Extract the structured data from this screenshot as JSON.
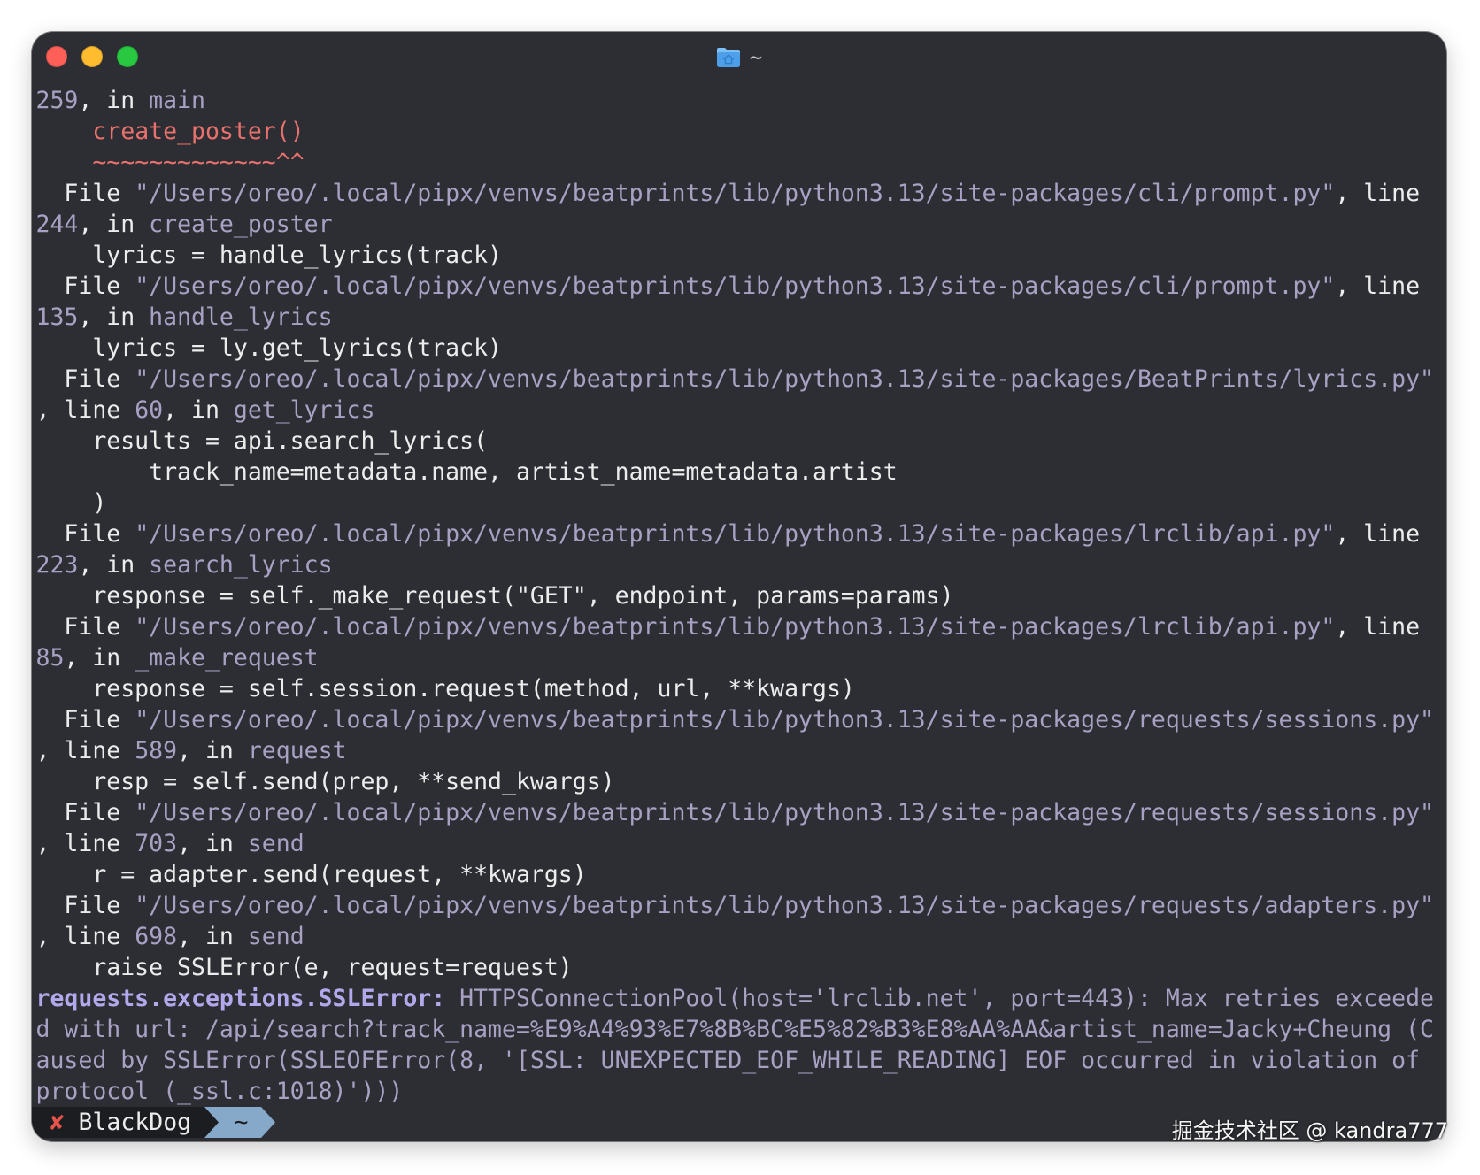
{
  "window": {
    "title": "~",
    "title_icon": "home-folder-icon"
  },
  "terminal": {
    "lines": [
      [
        {
          "text": "259",
          "color": "#a8a1c4"
        },
        {
          "text": ", in "
        },
        {
          "text": "main",
          "color": "#a8a1c4"
        }
      ],
      [
        {
          "text": "    "
        },
        {
          "text": "create_poster()",
          "color": "#e8716d"
        }
      ],
      [
        {
          "text": "    "
        },
        {
          "text": "~~~~~~~~~~~~~^^",
          "color": "#e8716d"
        }
      ],
      [
        {
          "text": "  File "
        },
        {
          "text": "\"/Users/oreo/.local/pipx/venvs/beatprints/lib/python3.13/site-packages/cli/prompt.py\"",
          "color": "#a8a1c4"
        },
        {
          "text": ", line"
        }
      ],
      [
        {
          "text": "244",
          "color": "#a8a1c4"
        },
        {
          "text": ", in "
        },
        {
          "text": "create_poster",
          "color": "#a8a1c4"
        }
      ],
      [
        {
          "text": "    lyrics = handle_lyrics(track)"
        }
      ],
      [
        {
          "text": "  File "
        },
        {
          "text": "\"/Users/oreo/.local/pipx/venvs/beatprints/lib/python3.13/site-packages/cli/prompt.py\"",
          "color": "#a8a1c4"
        },
        {
          "text": ", line"
        }
      ],
      [
        {
          "text": "135",
          "color": "#a8a1c4"
        },
        {
          "text": ", in "
        },
        {
          "text": "handle_lyrics",
          "color": "#a8a1c4"
        }
      ],
      [
        {
          "text": "    lyrics = ly.get_lyrics(track)"
        }
      ],
      [
        {
          "text": "  File "
        },
        {
          "text": "\"/Users/oreo/.local/pipx/venvs/beatprints/lib/python3.13/site-packages/BeatPrints/lyrics.py\"",
          "color": "#a8a1c4"
        }
      ],
      [
        {
          "text": ", line "
        },
        {
          "text": "60",
          "color": "#a8a1c4"
        },
        {
          "text": ", in "
        },
        {
          "text": "get_lyrics",
          "color": "#a8a1c4"
        }
      ],
      [
        {
          "text": "    results = api.search_lyrics("
        }
      ],
      [
        {
          "text": "        track_name=metadata.name, artist_name=metadata.artist"
        }
      ],
      [
        {
          "text": "    )"
        }
      ],
      [
        {
          "text": "  File "
        },
        {
          "text": "\"/Users/oreo/.local/pipx/venvs/beatprints/lib/python3.13/site-packages/lrclib/api.py\"",
          "color": "#a8a1c4"
        },
        {
          "text": ", line"
        }
      ],
      [
        {
          "text": "223",
          "color": "#a8a1c4"
        },
        {
          "text": ", in "
        },
        {
          "text": "search_lyrics",
          "color": "#a8a1c4"
        }
      ],
      [
        {
          "text": "    response = self._make_request(\"GET\", endpoint, params=params)"
        }
      ],
      [
        {
          "text": "  File "
        },
        {
          "text": "\"/Users/oreo/.local/pipx/venvs/beatprints/lib/python3.13/site-packages/lrclib/api.py\"",
          "color": "#a8a1c4"
        },
        {
          "text": ", line"
        }
      ],
      [
        {
          "text": "85",
          "color": "#a8a1c4"
        },
        {
          "text": ", in "
        },
        {
          "text": "_make_request",
          "color": "#a8a1c4"
        }
      ],
      [
        {
          "text": "    response = self.session.request(method, url, **kwargs)"
        }
      ],
      [
        {
          "text": "  File "
        },
        {
          "text": "\"/Users/oreo/.local/pipx/venvs/beatprints/lib/python3.13/site-packages/requests/sessions.py\"",
          "color": "#a8a1c4"
        }
      ],
      [
        {
          "text": ", line "
        },
        {
          "text": "589",
          "color": "#a8a1c4"
        },
        {
          "text": ", in "
        },
        {
          "text": "request",
          "color": "#a8a1c4"
        }
      ],
      [
        {
          "text": "    resp = self.send(prep, **send_kwargs)"
        }
      ],
      [
        {
          "text": "  File "
        },
        {
          "text": "\"/Users/oreo/.local/pipx/venvs/beatprints/lib/python3.13/site-packages/requests/sessions.py\"",
          "color": "#a8a1c4"
        }
      ],
      [
        {
          "text": ", line "
        },
        {
          "text": "703",
          "color": "#a8a1c4"
        },
        {
          "text": ", in "
        },
        {
          "text": "send",
          "color": "#a8a1c4"
        }
      ],
      [
        {
          "text": "    r = adapter.send(request, **kwargs)"
        }
      ],
      [
        {
          "text": "  File "
        },
        {
          "text": "\"/Users/oreo/.local/pipx/venvs/beatprints/lib/python3.13/site-packages/requests/adapters.py\"",
          "color": "#a8a1c4"
        }
      ],
      [
        {
          "text": ", line "
        },
        {
          "text": "698",
          "color": "#a8a1c4"
        },
        {
          "text": ", in "
        },
        {
          "text": "send",
          "color": "#a8a1c4"
        }
      ],
      [
        {
          "text": "    raise SSLError(e, request=request)"
        }
      ],
      [
        {
          "text": "requests.exceptions.SSLError:",
          "color": "#b3a8ec",
          "bold": true
        },
        {
          "text": " HTTPSConnectionPool(host='lrclib.net', port=443): Max retries exceede",
          "color": "#a8a1c4"
        }
      ],
      [
        {
          "text": "d with url: /api/search?track_name=%E9%A4%93%E7%8B%BC%E5%82%B3%E8%AA%AA&artist_name=Jacky+Cheung (C",
          "color": "#a8a1c4"
        }
      ],
      [
        {
          "text": "aused by SSLError(SSLEOFError(8, '[SSL: UNEXPECTED_EOF_WHILE_READING] EOF occurred in violation of",
          "color": "#a8a1c4"
        }
      ],
      [
        {
          "text": "protocol (_ssl.c:1018)')))",
          "color": "#a8a1c4"
        }
      ]
    ]
  },
  "prompt": {
    "status_symbol": "✘",
    "user": "BlackDog",
    "cwd": "~",
    "user_segment_color": "#1c1d20",
    "cwd_segment_color": "#86a8c9"
  },
  "watermark": {
    "text": "掘金技术社区 @ kandra777"
  }
}
